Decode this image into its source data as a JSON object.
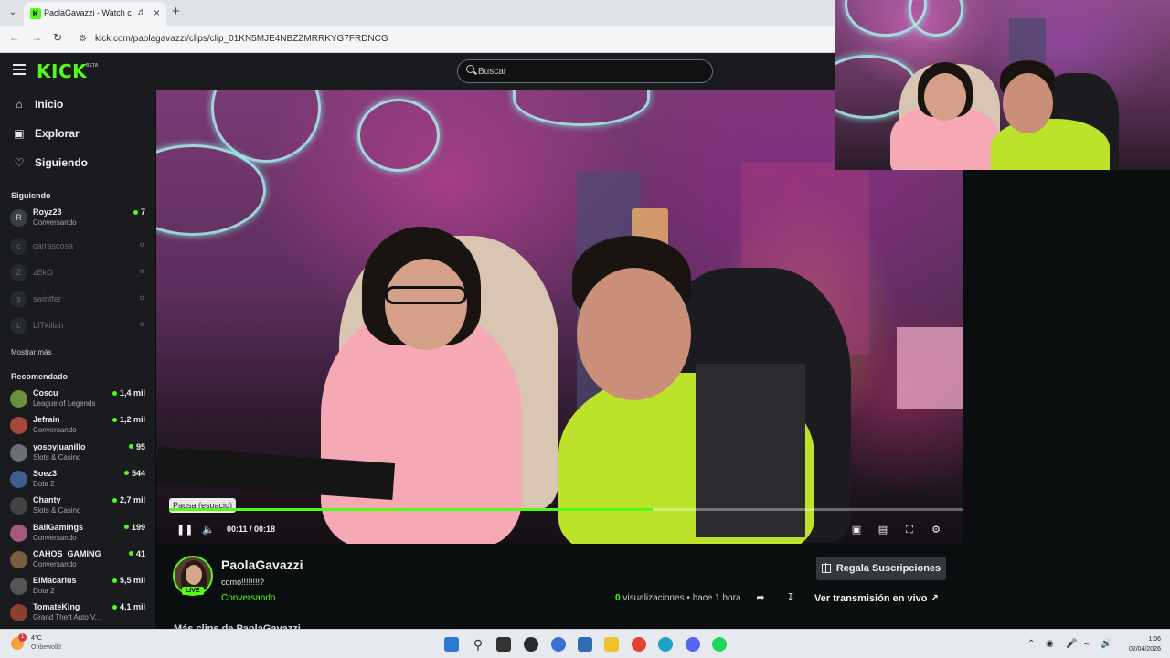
{
  "browser": {
    "tab_title": "PaolaGavazzi - Watch clips",
    "url": "kick.com/paolagavazzi/clips/clip_01KN5MJE4NBZZMRRKYG7FRDNCG"
  },
  "header": {
    "logo": "KICK",
    "logo_badge": "BETA",
    "search_placeholder": "Buscar"
  },
  "sidebar": {
    "nav": [
      {
        "label": "Inicio",
        "icon": "home-icon"
      },
      {
        "label": "Explorar",
        "icon": "compass-icon"
      },
      {
        "label": "Siguiendo",
        "icon": "heart-icon"
      }
    ],
    "following_title": "Siguiendo",
    "following": [
      {
        "name": "Royz23",
        "category": "Conversando",
        "viewers": "7",
        "live": true
      },
      {
        "name": "carrascosa",
        "live": false
      },
      {
        "name": "zEkO",
        "live": false
      },
      {
        "name": "swintfer",
        "live": false
      },
      {
        "name": "LITkillah",
        "live": false
      }
    ],
    "show_more": "Mostrar más",
    "recommended_title": "Recomendado",
    "recommended": [
      {
        "name": "Coscu",
        "category": "League of Legends",
        "viewers": "1,4 mil"
      },
      {
        "name": "Jefrain",
        "category": "Conversando",
        "viewers": "1,2 mil"
      },
      {
        "name": "yosoyjuanillo",
        "category": "Slots & Casino",
        "viewers": "95"
      },
      {
        "name": "Soez3",
        "category": "Dota 2",
        "viewers": "544"
      },
      {
        "name": "Chanty",
        "category": "Slots & Casino",
        "viewers": "2,7 mil"
      },
      {
        "name": "BaliGamings",
        "category": "Conversando",
        "viewers": "199"
      },
      {
        "name": "CAHOS_GAMING",
        "category": "Conversando",
        "viewers": "41"
      },
      {
        "name": "ElMacarius",
        "category": "Dota 2",
        "viewers": "5,5 mil"
      },
      {
        "name": "TomateKing",
        "category": "Grand Theft Auto V...",
        "viewers": "4,1 mil"
      }
    ]
  },
  "player": {
    "tooltip": "Pausa (espacio)",
    "time": "00:11 / 00:18",
    "progress": 0.61
  },
  "clip": {
    "streamer": "PaolaGavazzi",
    "title": "como!!!!!!!!?",
    "category": "Conversando",
    "live_badge": "LIVE",
    "views_count": "0",
    "views_label": "visualizaciones",
    "separator": "•",
    "time_ago": "hace 1 hora",
    "subs_button": "Regala Suscripciones",
    "watch_live": "Ver transmisión en vivo",
    "more_clips": "Más clips de PaolaGavazzi"
  },
  "taskbar": {
    "weather_temp": "4°C",
    "weather_cond": "Onbewolkt",
    "notif_count": "1",
    "time": "1:06",
    "date": "02/04/2026"
  },
  "colors": {
    "accent": "#53fc18",
    "sidebar_bg": "#191b1f",
    "page_bg": "#0b0e0f"
  }
}
